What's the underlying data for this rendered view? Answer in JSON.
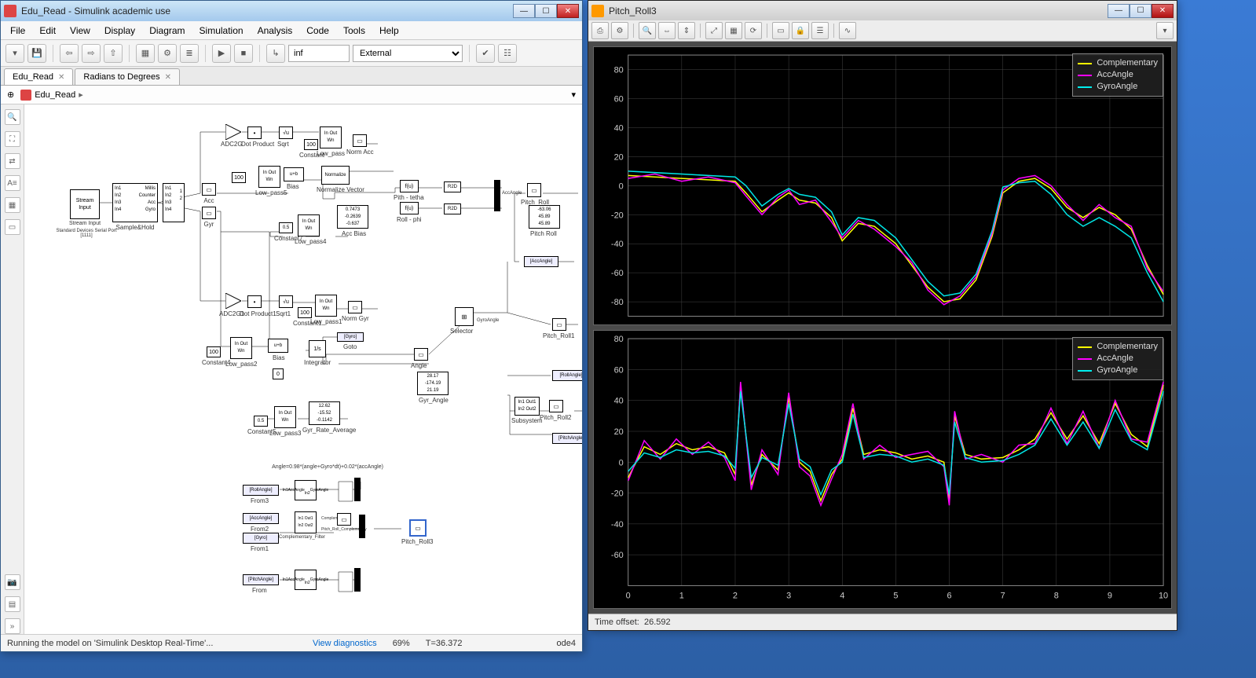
{
  "sim": {
    "title": "Edu_Read - Simulink academic use",
    "menu": [
      "File",
      "Edit",
      "View",
      "Display",
      "Diagram",
      "Simulation",
      "Analysis",
      "Code",
      "Tools",
      "Help"
    ],
    "stoptime": "inf",
    "mode": "External",
    "tabs": [
      {
        "label": "Edu_Read"
      },
      {
        "label": "Radians to Degrees"
      }
    ],
    "breadcrumb": "Edu_Read",
    "status": {
      "msg": "Running the model on 'Simulink Desktop Real-Time'...",
      "diag": "View diagnostics",
      "pct": "69%",
      "t": "T=36.372",
      "solver": "ode4"
    },
    "blocks": {
      "stream_input": "Stream Input",
      "stream_sub": "Standard Devices\nSerial Port [1111]",
      "samplehold": "Sample&Hold",
      "acc": "Acc",
      "gyr": "Gyr",
      "adc2g": "ADC2G",
      "dotprod": "Dot Product",
      "sqrt": "Sqrt",
      "const": "Constant",
      "const100": "100",
      "lowpass": "Low_pass",
      "normacc": "Norm Acc",
      "lowpass5": "Low_pass5",
      "normalize": "Normalize",
      "normvec": "Normalize Vector",
      "bias": "Bias",
      "pitchteta": "Pith - tetha",
      "rollphi": "Roll - phi",
      "r2d": "R2D",
      "accangle": "AccAngle",
      "pitchroll": "Pitch_Roll",
      "const7": "Constant7",
      "const7val": "0.5",
      "lowpass4": "Low_pass4",
      "accbias": "Acc Bias",
      "accbias_v": [
        "0.7473",
        "-0.2639",
        "-0.637"
      ],
      "pitchroll_v": [
        "-63.06",
        "45.89",
        "45.89"
      ],
      "adc2g1": "ADC2G1",
      "dotprod1": "Dot Product1",
      "sqrt1": "Sqrt1",
      "const1": "Constant1",
      "lowpass1": "Low_pass1",
      "normgyr": "Norm Gyr",
      "const4": "Constant4",
      "lowpass2": "Low_pass2",
      "bias1": "Bias",
      "integrator": "Integrator",
      "goto_gyro": "[Gyro]",
      "goto": "Goto",
      "angle": "Angle",
      "selector": "Selector",
      "gyrangle": "GyroAngle",
      "pitchroll1": "Pitch_Roll1",
      "gyrangle_v": [
        "28.17",
        "-174.19",
        "21.19"
      ],
      "gyrangle_lbl": "Gyr_Angle",
      "const5": "Constant5",
      "lowpass3": "Low_pass3",
      "gyrrate_v": [
        "12.62",
        "-15.52",
        "-0.1142"
      ],
      "gyrrate_lbl": "Gyr_Rate_Average",
      "rollangle": "[RollAngle]",
      "subsystem": "Subsystem",
      "pitchroll2": "Pitch_Roll2",
      "pitchangle": "[PitchAngle]",
      "formula": "Angle=0.98*(angle+Gyro*dt)+0.02*(accAngle)",
      "from3": "From3",
      "from2": "From2",
      "from1": "From1",
      "from": "From",
      "from_roll": "[RollAngle]",
      "from_acc": "[AccAngle]",
      "from_gyro": "[Gyro]",
      "from_pitch": "[PitchAngle]",
      "compfilt": "Complementary_Filter",
      "prcomp": "Pitch_Roll_Complemntary",
      "complem": "Complementary",
      "pitchroll3": "Pitch_Roll3",
      "accangle_s": "AccAngle",
      "gyroangle_s": "GyroAngle",
      "fu": "f(u)"
    }
  },
  "scope": {
    "title": "Pitch_Roll3",
    "time_offset_lbl": "Time offset:",
    "time_offset": "26.592",
    "legend": [
      "Complementary",
      "AccAngle",
      "GyroAngle"
    ],
    "legend_colors": [
      "#ffff00",
      "#ff00ff",
      "#00e5e5"
    ]
  },
  "chart_data": [
    {
      "type": "line",
      "title": "",
      "xlabel": "",
      "ylabel": "",
      "xlim": [
        0,
        10
      ],
      "ylim": [
        -90,
        90
      ],
      "xticks": [
        0,
        1,
        2,
        3,
        4,
        5,
        6,
        7,
        8,
        9,
        10
      ],
      "yticks": [
        -80,
        -60,
        -40,
        -20,
        0,
        20,
        40,
        60,
        80
      ],
      "series": [
        {
          "name": "Complementary",
          "color": "#ffff00",
          "x": [
            0,
            0.5,
            1,
            1.5,
            2,
            2.2,
            2.5,
            2.8,
            3,
            3.2,
            3.5,
            3.8,
            4,
            4.3,
            4.6,
            5,
            5.3,
            5.6,
            5.9,
            6.2,
            6.5,
            6.8,
            7,
            7.3,
            7.6,
            7.9,
            8.2,
            8.5,
            8.8,
            9.1,
            9.4,
            9.7,
            10
          ],
          "y": [
            7,
            6,
            5,
            4,
            3,
            -5,
            -18,
            -10,
            -5,
            -10,
            -12,
            -22,
            -38,
            -26,
            -28,
            -40,
            -55,
            -70,
            -80,
            -78,
            -65,
            -35,
            -5,
            3,
            5,
            -2,
            -15,
            -22,
            -15,
            -20,
            -30,
            -55,
            -75
          ]
        },
        {
          "name": "AccAngle",
          "color": "#ff00ff",
          "x": [
            0,
            0.5,
            1,
            1.5,
            2,
            2.2,
            2.5,
            2.8,
            3,
            3.2,
            3.5,
            3.8,
            4,
            4.3,
            4.6,
            5,
            5.3,
            5.6,
            5.9,
            6.2,
            6.5,
            6.8,
            7,
            7.3,
            7.6,
            7.9,
            8.2,
            8.5,
            8.8,
            9.1,
            9.4,
            9.7,
            10
          ],
          "y": [
            5,
            8,
            3,
            6,
            2,
            -7,
            -20,
            -8,
            -3,
            -13,
            -10,
            -25,
            -36,
            -24,
            -30,
            -42,
            -53,
            -72,
            -82,
            -76,
            -63,
            -33,
            -3,
            5,
            7,
            0,
            -13,
            -24,
            -13,
            -22,
            -28,
            -57,
            -73
          ]
        },
        {
          "name": "GyroAngle",
          "color": "#00e5e5",
          "x": [
            0,
            0.5,
            1,
            1.5,
            2,
            2.2,
            2.5,
            2.8,
            3,
            3.2,
            3.5,
            3.8,
            4,
            4.3,
            4.6,
            5,
            5.3,
            5.6,
            5.9,
            6.2,
            6.5,
            6.8,
            7,
            7.3,
            7.6,
            7.9,
            8.2,
            8.5,
            8.8,
            9.1,
            9.4,
            9.7,
            10
          ],
          "y": [
            10,
            9,
            8,
            7,
            6,
            0,
            -14,
            -6,
            -2,
            -6,
            -8,
            -18,
            -34,
            -22,
            -24,
            -36,
            -51,
            -66,
            -76,
            -74,
            -61,
            -31,
            -1,
            2,
            3,
            -6,
            -20,
            -28,
            -22,
            -28,
            -36,
            -60,
            -80
          ]
        }
      ]
    },
    {
      "type": "line",
      "title": "",
      "xlabel": "",
      "ylabel": "",
      "xlim": [
        0,
        10
      ],
      "ylim": [
        -80,
        80
      ],
      "xticks": [
        0,
        1,
        2,
        3,
        4,
        5,
        6,
        7,
        8,
        9,
        10
      ],
      "yticks": [
        -60,
        -40,
        -20,
        0,
        20,
        40,
        60,
        80
      ],
      "series": [
        {
          "name": "Complementary",
          "color": "#ffff00",
          "x": [
            0,
            0.3,
            0.6,
            0.9,
            1.2,
            1.5,
            1.8,
            2,
            2.1,
            2.3,
            2.5,
            2.8,
            3,
            3.2,
            3.4,
            3.6,
            3.8,
            4,
            4.2,
            4.4,
            4.7,
            5,
            5.3,
            5.6,
            5.9,
            6,
            6.1,
            6.3,
            6.6,
            7,
            7.3,
            7.6,
            7.9,
            8.2,
            8.5,
            8.8,
            9.1,
            9.4,
            9.7,
            10
          ],
          "y": [
            -10,
            10,
            5,
            12,
            8,
            10,
            6,
            -8,
            50,
            -15,
            5,
            -5,
            42,
            0,
            -6,
            -25,
            -8,
            2,
            35,
            5,
            8,
            6,
            2,
            4,
            0,
            -25,
            30,
            5,
            2,
            3,
            8,
            15,
            32,
            15,
            30,
            12,
            38,
            18,
            10,
            50
          ]
        },
        {
          "name": "AccAngle",
          "color": "#ff00ff",
          "x": [
            0,
            0.3,
            0.6,
            0.9,
            1.2,
            1.5,
            1.8,
            2,
            2.1,
            2.3,
            2.5,
            2.8,
            3,
            3.2,
            3.4,
            3.6,
            3.8,
            4,
            4.2,
            4.4,
            4.7,
            5,
            5.3,
            5.6,
            5.9,
            6,
            6.1,
            6.3,
            6.6,
            7,
            7.3,
            7.6,
            7.9,
            8.2,
            8.5,
            8.8,
            9.1,
            9.4,
            9.7,
            10
          ],
          "y": [
            -12,
            14,
            2,
            15,
            5,
            13,
            3,
            -12,
            52,
            -18,
            8,
            -8,
            45,
            -3,
            -9,
            -28,
            -11,
            5,
            38,
            2,
            11,
            3,
            5,
            7,
            -3,
            -28,
            33,
            2,
            5,
            0,
            11,
            12,
            35,
            12,
            33,
            9,
            40,
            15,
            13,
            52
          ]
        },
        {
          "name": "GyroAngle",
          "color": "#00e5e5",
          "x": [
            0,
            0.3,
            0.6,
            0.9,
            1.2,
            1.5,
            1.8,
            2,
            2.1,
            2.3,
            2.5,
            2.8,
            3,
            3.2,
            3.4,
            3.6,
            3.8,
            4,
            4.2,
            4.4,
            4.7,
            5,
            5.3,
            5.6,
            5.9,
            6,
            6.1,
            6.3,
            6.6,
            7,
            7.3,
            7.6,
            7.9,
            8.2,
            8.5,
            8.8,
            9.1,
            9.4,
            9.7,
            10
          ],
          "y": [
            -6,
            6,
            3,
            8,
            6,
            7,
            4,
            -4,
            46,
            -10,
            3,
            -2,
            38,
            2,
            -3,
            -21,
            -5,
            0,
            31,
            3,
            5,
            4,
            0,
            2,
            -2,
            -21,
            26,
            3,
            0,
            1,
            5,
            11,
            28,
            11,
            26,
            9,
            34,
            14,
            8,
            46
          ]
        }
      ]
    }
  ]
}
